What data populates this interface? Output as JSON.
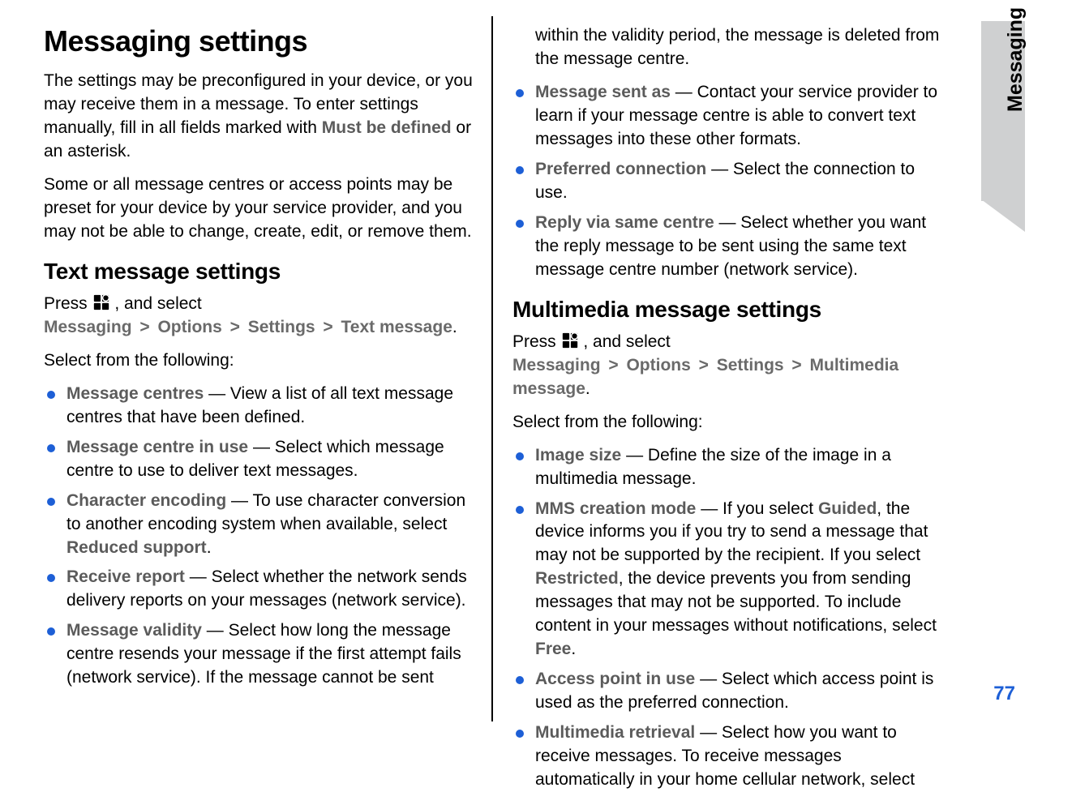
{
  "sideTab": "Messaging",
  "pageNumber": "77",
  "left": {
    "h1": "Messaging settings",
    "para1_a": "The settings may be preconfigured in your device, or you may receive them in a message. To enter settings manually, fill in all fields marked with ",
    "para1_b": "Must be defined",
    "para1_c": " or an asterisk.",
    "para2": "Some or all message centres or access points may be preset for your device by your service provider, and you may not be able to change, create, edit, or remove them.",
    "h2": "Text message settings",
    "press": "Press ",
    "and_select": " , and select ",
    "crumb1": "Messaging",
    "crumb2": "Options",
    "crumb3": "Settings",
    "crumb4": "Text message",
    "period": ".",
    "select_from": "Select from the following:",
    "items": [
      {
        "label": "Message centres",
        "text": " — View a list of all text message centres that have been defined."
      },
      {
        "label": "Message centre in use",
        "text": "  — Select which message centre to use to deliver text messages."
      },
      {
        "label": "Character encoding",
        "text_a": " — To use character conversion to another encoding system when available, select ",
        "bold_tail": "Reduced support",
        "text_b": "."
      },
      {
        "label": "Receive report",
        "text": " — Select whether the network sends delivery reports on your messages (network service)."
      },
      {
        "label": "Message validity",
        "text": " — Select how long the message centre resends your message if the first attempt fails (network service). If the message cannot be sent"
      }
    ]
  },
  "right": {
    "cont": "within the validity period, the message is deleted from the message centre.",
    "items_top": [
      {
        "label": "Message sent as",
        "text": "  — Contact your service provider to learn if your message centre is able to convert text messages into these other formats."
      },
      {
        "label": "Preferred connection",
        "text": " — Select the connection to use."
      },
      {
        "label": "Reply via same centre",
        "text": " — Select whether you want the reply message to be sent using the same text message centre number (network service)."
      }
    ],
    "h2": "Multimedia message settings",
    "press": "Press ",
    "and_select": " , and select ",
    "crumb1": "Messaging",
    "crumb2": "Options",
    "crumb3": "Settings",
    "crumb4": "Multimedia message",
    "period": ".",
    "select_from": "Select from the following:",
    "items_bottom": [
      {
        "label": "Image size",
        "text": "  — Define the size of the image in a multimedia message."
      },
      {
        "label": "MMS creation mode",
        "text_a": "  — If you select ",
        "bold1": "Guided",
        "text_b": ", the device informs you if you try to send a message that may not be supported by the recipient. If you select ",
        "bold2": "Restricted",
        "text_c": ", the device prevents you from sending messages that may not be supported. To include content in your messages without notifications, select ",
        "bold3": "Free",
        "text_d": "."
      },
      {
        "label": "Access point in use",
        "text": "  — Select which access point is used as the preferred connection."
      },
      {
        "label": "Multimedia retrieval",
        "text": "  — Select how you want to receive messages. To receive messages automatically in your home cellular network, select"
      }
    ]
  }
}
